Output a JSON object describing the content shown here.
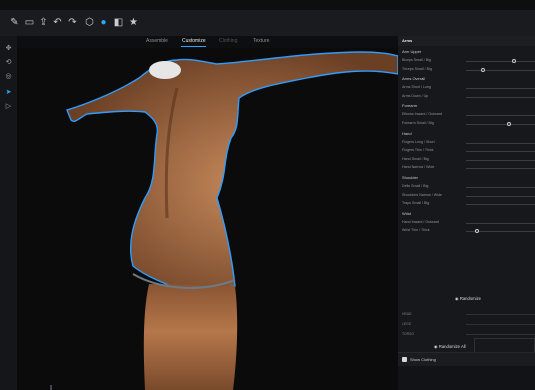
{
  "toolbar": {
    "icons": [
      "pencil-icon",
      "picture-icon",
      "export-icon",
      "undo-icon",
      "redo-icon",
      "hex-icon",
      "sphere-icon",
      "cube-icon",
      "star-icon"
    ]
  },
  "tabs": [
    {
      "label": "Assemble",
      "state": "normal"
    },
    {
      "label": "Customize",
      "state": "active"
    },
    {
      "label": "Clothing",
      "state": "disabled"
    },
    {
      "label": "Texture",
      "state": "normal"
    }
  ],
  "leftbar": {
    "icons": [
      "move-icon",
      "rotate-icon",
      "globe-icon",
      "cursor-icon",
      "play-icon"
    ]
  },
  "panel": {
    "title": "Arms",
    "sections": [
      {
        "name": "Arm Upper",
        "rows": [
          {
            "label": "Biceps Small / Big",
            "value": 0.7
          },
          {
            "label": "Triceps Small / Big",
            "value": 0.25
          }
        ]
      },
      {
        "name": "Arms Overall",
        "rows": [
          {
            "label": "Arms Short / Long",
            "value": null
          },
          {
            "label": "Arms Down / Up",
            "value": null
          }
        ]
      },
      {
        "name": "Forearm",
        "rows": [
          {
            "label": "Elbows Inward / Outward",
            "value": null
          },
          {
            "label": "Forearm Small / Big",
            "value": 0.62
          }
        ]
      },
      {
        "name": "Hand",
        "rows": [
          {
            "label": "Fingers Long / Short",
            "value": null
          },
          {
            "label": "Fingers Thin / Thick",
            "value": null
          },
          {
            "label": "Hand Small / Big",
            "value": null
          },
          {
            "label": "Hand Narrow / Wide",
            "value": null
          }
        ]
      },
      {
        "name": "Shoulder",
        "rows": [
          {
            "label": "Delts Small / Big",
            "value": null
          },
          {
            "label": "Shoulders Narrow / Wide",
            "value": null
          },
          {
            "label": "Traps Small / Big",
            "value": null
          }
        ]
      },
      {
        "name": "Wrist",
        "rows": [
          {
            "label": "Hand Inward / Outward",
            "value": null
          },
          {
            "label": "Wrist Thin / Thick",
            "value": 0.16
          }
        ]
      }
    ],
    "randomize_label": "Randomize",
    "randomize_rows": [
      "HEAD",
      "LEGS",
      "TORSO"
    ],
    "randomize_all_label": "Randomize All",
    "show_clothing_label": "Show Clothing"
  },
  "colors": {
    "accent": "#2ea3ff",
    "outline": "#2f9dff",
    "skin": "#b5774a"
  }
}
